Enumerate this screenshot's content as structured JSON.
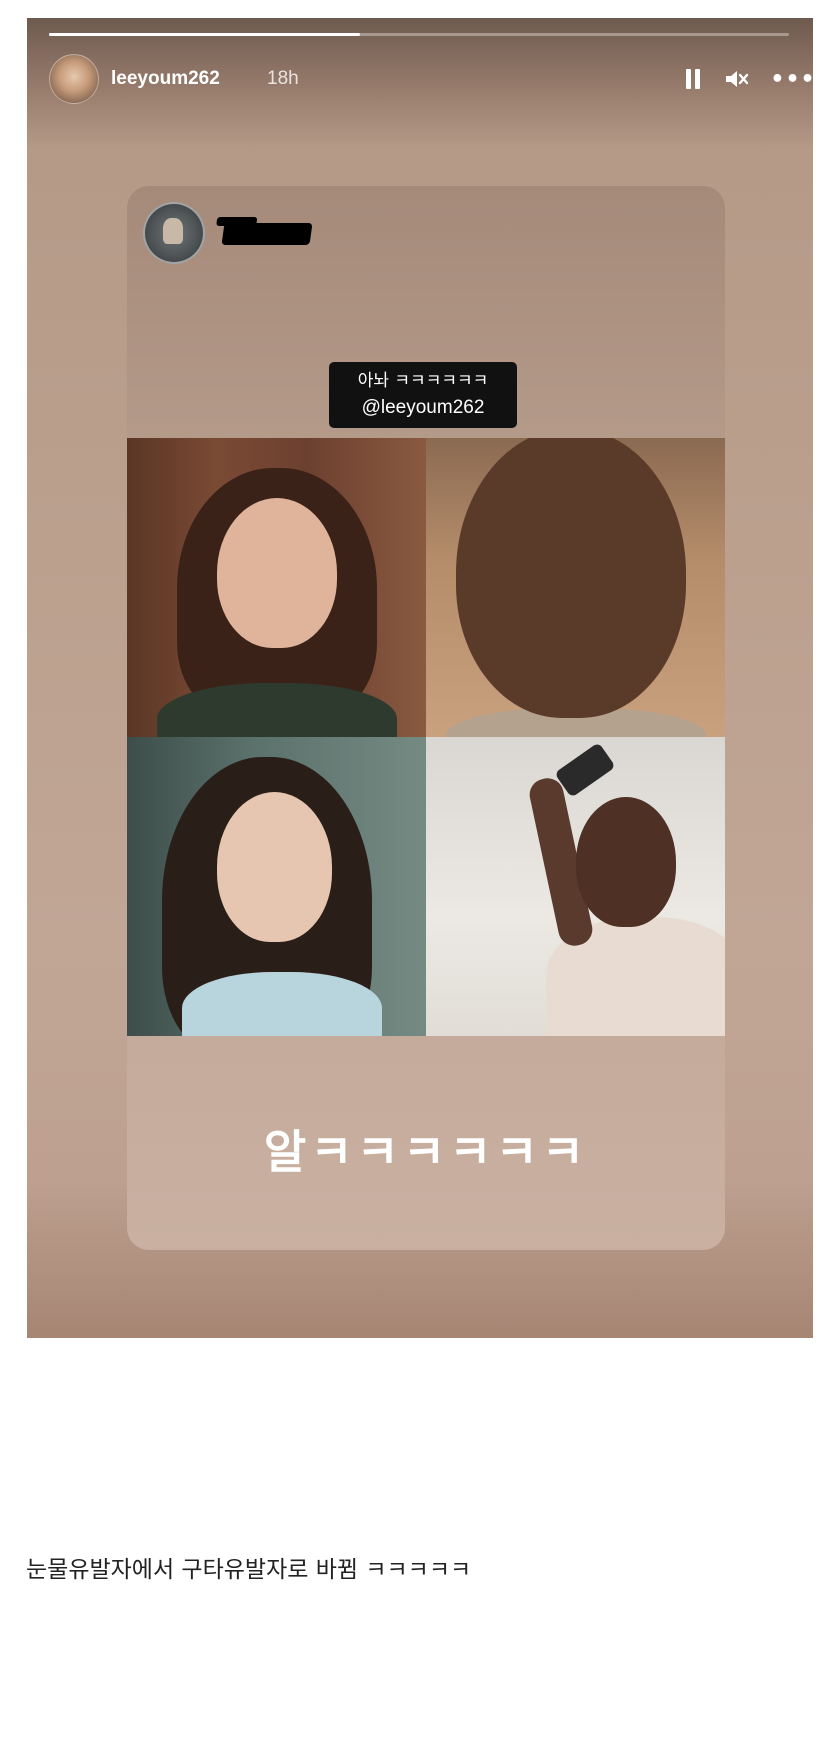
{
  "story": {
    "progress": 0.42,
    "username": "leeyoum262",
    "time": "18h",
    "controls": {
      "pause_icon": "pause-icon",
      "mute_icon": "speaker-muted-icon",
      "more_icon": "more-horizontal-icon",
      "mute_glyph": "🔇",
      "more_glyph": "•••"
    }
  },
  "shared_post": {
    "mention_line1": "아놔 ㅋㅋㅋㅋㅋㅋ",
    "mention_line2": "@leeyoum262",
    "bottom_text": "알ㅋㅋㅋㅋㅋㅋ"
  },
  "caption": "눈물유발자에서 구타유발자로 바뀜 ㅋㅋㅋㅋㅋ"
}
